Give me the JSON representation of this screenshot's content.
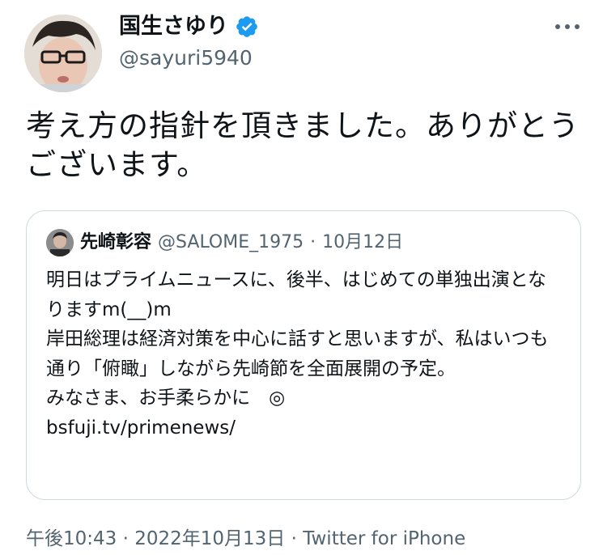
{
  "author": {
    "display_name": "国生さゆり",
    "handle": "@sayuri5940",
    "verified": true
  },
  "tweet": {
    "text": "考え方の指針を頂きました。ありがとうございます。"
  },
  "quoted": {
    "display_name": "先崎彰容",
    "handle": "@SALOME_1975",
    "separator": "·",
    "date": "10月12日",
    "text": "明日はプライムニュースに、後半、はじめての単独出演となりますm(__)m\n岸田総理は経済対策を中心に話すと思いますが、私はいつも通り「俯瞰」しながら先崎節を全面展開の予定。\nみなさま、お手柔らかに　◎\nbsfuji.tv/primenews/"
  },
  "meta": {
    "time": "午後10:43",
    "separator1": "·",
    "date": "2022年10月13日",
    "separator2": "·",
    "source": "Twitter for iPhone"
  },
  "icons": {
    "verified": "verified-badge-icon",
    "more": "more-options-icon"
  },
  "colors": {
    "verified_blue": "#1d9bf0",
    "text_primary": "#0f1419",
    "text_secondary": "#536471",
    "border": "#cfd9de"
  }
}
